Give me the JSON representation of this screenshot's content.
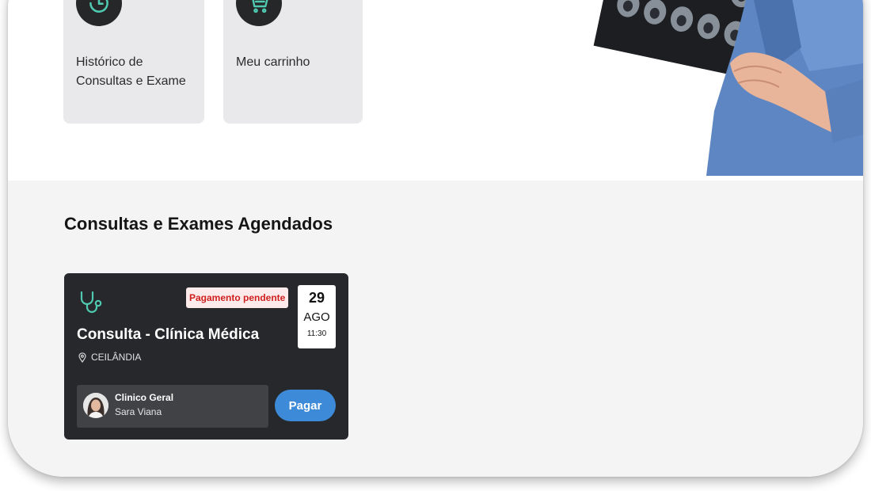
{
  "shortcuts": [
    {
      "label": "Histórico de Consultas e Exame",
      "icon": "history-clock-icon"
    },
    {
      "label": "Meu carrinho",
      "icon": "shopping-cart-icon"
    }
  ],
  "hero": {
    "image": "doctor-holding-xray-photo"
  },
  "scheduled": {
    "title": "Consultas e Exames Agendados",
    "appointments": [
      {
        "icon": "stethoscope-icon",
        "status": "Pagamento pendente",
        "day": "29",
        "month": "AGO",
        "time": "11:30",
        "title": "Consulta - Clínica Médica",
        "location": "CEILÂNDIA",
        "doctor": {
          "specialty": "Clinico Geral",
          "name": "Sara Viana"
        },
        "action_label": "Pagar"
      }
    ]
  },
  "colors": {
    "accent": "#3c8ad8",
    "icon_teal": "#4fc9b0",
    "status_red": "#cf2020",
    "card_dark": "#26282b",
    "section_bg": "#f4f4f4",
    "shortcut_bg": "#e9e9eb"
  }
}
